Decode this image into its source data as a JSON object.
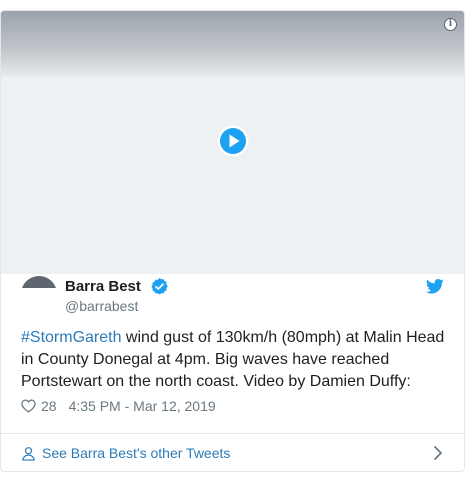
{
  "tweet": {
    "author_name": "Barra Best",
    "author_handle": "@barrabest",
    "hashtag": "#StormGareth",
    "body": " wind gust of 130km/h (80mph) at Malin Head in County Donegal at 4pm.  Big waves have reached Portstewart on the north coast. Video by Damien Duffy:",
    "likes": "28",
    "timestamp": "4:35 PM - Mar 12, 2019",
    "footer_link": "See Barra Best's other Tweets"
  },
  "colors": {
    "link": "#2b7bb9",
    "verified": "#1da1f2",
    "muted": "#697882"
  },
  "icons": {
    "info": "info-icon",
    "play": "play-icon",
    "verified": "verified-badge-icon",
    "brand": "twitter-bird-icon",
    "like": "heart-icon",
    "profile": "person-icon",
    "next": "chevron-right-icon"
  }
}
